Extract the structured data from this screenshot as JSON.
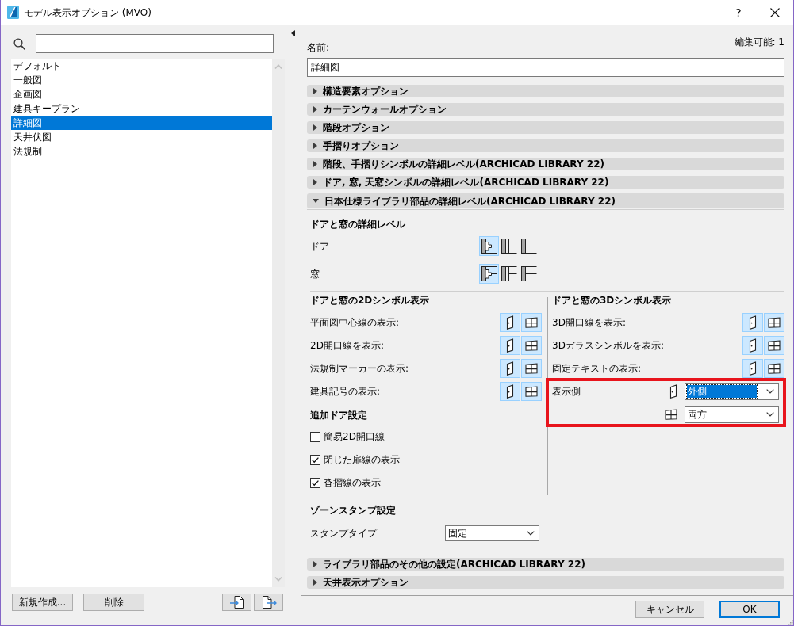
{
  "window": {
    "title": "モデル表示オプション (MVO)",
    "help": "?"
  },
  "sidebar": {
    "presets": [
      {
        "label": "デフォルト",
        "selected": false
      },
      {
        "label": "一般図",
        "selected": false
      },
      {
        "label": "企画図",
        "selected": false
      },
      {
        "label": "建具キープラン",
        "selected": false
      },
      {
        "label": "詳細図",
        "selected": true
      },
      {
        "label": "天井伏図",
        "selected": false
      },
      {
        "label": "法規制",
        "selected": false
      }
    ],
    "buttons": [
      {
        "kind": "text",
        "label": "新規作成..."
      },
      {
        "kind": "text",
        "label": "削除"
      },
      {
        "kind": "import"
      },
      {
        "kind": "export"
      }
    ]
  },
  "panel": {
    "editable": "編集可能: 1",
    "name": {
      "label": "名前:",
      "value": "詳細図"
    },
    "sections": [
      {
        "title": "構造要素オプション",
        "expanded": false
      },
      {
        "title": "カーテンウォールオプション",
        "expanded": false
      },
      {
        "title": "階段オプション",
        "expanded": false
      },
      {
        "title": "手摺りオプション",
        "expanded": false
      },
      {
        "title": "階段、手摺りシンボルの詳細レベル(ARCHICAD LIBRARY 22)",
        "expanded": false
      },
      {
        "title": "ドア, 窓, 天窓シンボルの詳細レベル(ARCHICAD LIBRARY 22)",
        "expanded": false
      },
      {
        "title": "日本仕様ライブラリ部品の詳細レベル(ARCHICAD LIBRARY 22)",
        "expanded": true,
        "content": {
          "detail_level": {
            "title": "ドアと窓の詳細レベル",
            "rows": [
              {
                "label": "ドア",
                "options": [
                  {
                    "kind": "detailed",
                    "selected": true
                  },
                  {
                    "kind": "split",
                    "selected": false
                  },
                  {
                    "kind": "simple",
                    "selected": false
                  }
                ]
              },
              {
                "label": "窓",
                "options": [
                  {
                    "kind": "detailed",
                    "selected": true
                  },
                  {
                    "kind": "split",
                    "selected": false
                  },
                  {
                    "kind": "simple",
                    "selected": false
                  }
                ]
              }
            ]
          },
          "symbols_2d": {
            "title": "ドアと窓の2Dシンボル表示",
            "rows": [
              {
                "label": "平面図中心線の表示:",
                "toggles": [
                  {
                    "kind": "door",
                    "on": true
                  },
                  {
                    "kind": "window",
                    "on": true
                  }
                ]
              },
              {
                "label": "2D開口線を表示:",
                "toggles": [
                  {
                    "kind": "door",
                    "on": true
                  },
                  {
                    "kind": "window",
                    "on": true
                  }
                ]
              },
              {
                "label": "法規制マーカーの表示:",
                "toggles": [
                  {
                    "kind": "door",
                    "on": true
                  },
                  {
                    "kind": "window",
                    "on": true
                  }
                ]
              },
              {
                "label": "建具記号の表示:",
                "toggles": [
                  {
                    "kind": "door",
                    "on": true
                  },
                  {
                    "kind": "window",
                    "on": true
                  }
                ]
              }
            ]
          },
          "extra_door": {
            "title": "追加ドア設定",
            "options": [
              {
                "label": "簡易2D開口線",
                "checked": false
              },
              {
                "label": "閉じた扉線の表示",
                "checked": true
              },
              {
                "label": "沓摺線の表示",
                "checked": true
              }
            ]
          },
          "symbols_3d": {
            "title": "ドアと窓の3Dシンボル表示",
            "rows": [
              {
                "label": "3D開口線を表示:",
                "toggles": [
                  {
                    "kind": "door",
                    "on": true
                  },
                  {
                    "kind": "window",
                    "on": true
                  }
                ]
              },
              {
                "label": "3Dガラスシンボルを表示:",
                "toggles": [
                  {
                    "kind": "door",
                    "on": true
                  },
                  {
                    "kind": "window",
                    "on": true
                  }
                ]
              },
              {
                "label": "固定テキストの表示:",
                "toggles": [
                  {
                    "kind": "door",
                    "on": true
                  },
                  {
                    "kind": "window",
                    "on": true
                  }
                ]
              }
            ],
            "display_side": {
              "label": "表示側",
              "highlighted": true,
              "selects": [
                {
                  "kind": "door",
                  "value": "外側",
                  "focused": true
                },
                {
                  "kind": "window",
                  "value": "両方",
                  "focused": false
                }
              ]
            }
          },
          "zone_stamp": {
            "title": "ゾーンスタンプ設定",
            "label": "スタンプタイプ",
            "value": "固定"
          }
        }
      },
      {
        "title": "ライブラリ部品のその他の設定(ARCHICAD LIBRARY 22)",
        "expanded": false
      },
      {
        "title": "天井表示オプション",
        "expanded": false
      }
    ]
  },
  "buttons": [
    {
      "label": "キャンセル",
      "default": false
    },
    {
      "label": "OK",
      "default": true
    }
  ]
}
